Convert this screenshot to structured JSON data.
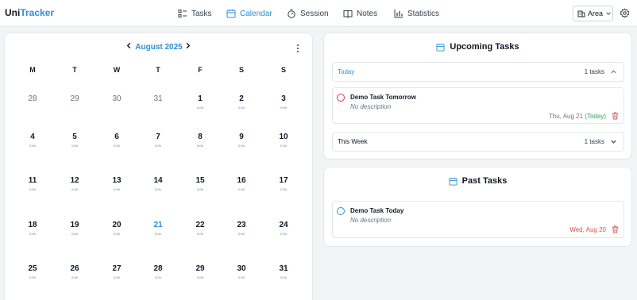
{
  "app": {
    "logo_prefix": "Uni",
    "logo_accent": "Tracker"
  },
  "nav": {
    "tasks": "Tasks",
    "calendar": "Calendar",
    "session": "Session",
    "notes": "Notes",
    "statistics": "Statistics"
  },
  "area_select": {
    "selected": "Area"
  },
  "calendar": {
    "month_label": "August 2025",
    "weekdays": [
      "M",
      "T",
      "W",
      "T",
      "F",
      "S",
      "S"
    ],
    "weeks": [
      [
        {
          "d": "28",
          "h": "",
          "m": true
        },
        {
          "d": "29",
          "h": "",
          "m": true
        },
        {
          "d": "30",
          "h": "",
          "m": true
        },
        {
          "d": "31",
          "h": "",
          "m": true
        },
        {
          "d": "1",
          "h": "0.0h"
        },
        {
          "d": "2",
          "h": "0.0h"
        },
        {
          "d": "3",
          "h": "0.0h"
        }
      ],
      [
        {
          "d": "4",
          "h": "0.0h"
        },
        {
          "d": "5",
          "h": "0.0h"
        },
        {
          "d": "6",
          "h": "0.0h"
        },
        {
          "d": "7",
          "h": "0.0h"
        },
        {
          "d": "8",
          "h": "0.0h"
        },
        {
          "d": "9",
          "h": "0.0h"
        },
        {
          "d": "10",
          "h": "0.0h"
        }
      ],
      [
        {
          "d": "11",
          "h": "0.0h"
        },
        {
          "d": "12",
          "h": "0.0h"
        },
        {
          "d": "13",
          "h": "0.0h"
        },
        {
          "d": "14",
          "h": "0.0h"
        },
        {
          "d": "15",
          "h": "0.0h"
        },
        {
          "d": "16",
          "h": "0.0h"
        },
        {
          "d": "17",
          "h": "0.0h"
        }
      ],
      [
        {
          "d": "18",
          "h": "0.0h"
        },
        {
          "d": "19",
          "h": "0.0h"
        },
        {
          "d": "20",
          "h": "0.0h"
        },
        {
          "d": "21",
          "h": "0.0h",
          "t": true
        },
        {
          "d": "22",
          "h": "0.0h"
        },
        {
          "d": "23",
          "h": "0.0h"
        },
        {
          "d": "24",
          "h": "0.0h"
        }
      ],
      [
        {
          "d": "25",
          "h": "0.0h"
        },
        {
          "d": "26",
          "h": "0.0h"
        },
        {
          "d": "27",
          "h": "0.0h"
        },
        {
          "d": "28",
          "h": "0.0h"
        },
        {
          "d": "29",
          "h": "0.0h"
        },
        {
          "d": "30",
          "h": "0.0h"
        },
        {
          "d": "31",
          "h": "0.0h"
        }
      ]
    ]
  },
  "upcoming": {
    "title": "Upcoming Tasks",
    "today_group": {
      "label": "Today",
      "count": "1 tasks"
    },
    "task": {
      "title": "Demo Task Tomorrow",
      "description": "No description",
      "date": "Thu, Aug 21",
      "relative": "(Today)"
    },
    "week_group": {
      "label": "This Week",
      "count": "1 tasks"
    }
  },
  "past": {
    "title": "Past Tasks",
    "task": {
      "title": "Demo Task Today",
      "description": "No description",
      "date": "Wed, Aug 20"
    }
  },
  "colors": {
    "accent": "#2b8fd6",
    "overdue": "#e24c4c",
    "today_green": "#22a55b",
    "pending_circle": "#d33a4a"
  },
  "icons": [
    "tasks-icon",
    "calendar-icon",
    "stopwatch-icon",
    "book-icon",
    "bar-chart-icon",
    "building-icon",
    "chevron-down-icon",
    "gear-icon",
    "chevron-left-icon",
    "chevron-right-icon",
    "more-vertical-icon",
    "chevron-up-icon",
    "trash-icon"
  ]
}
